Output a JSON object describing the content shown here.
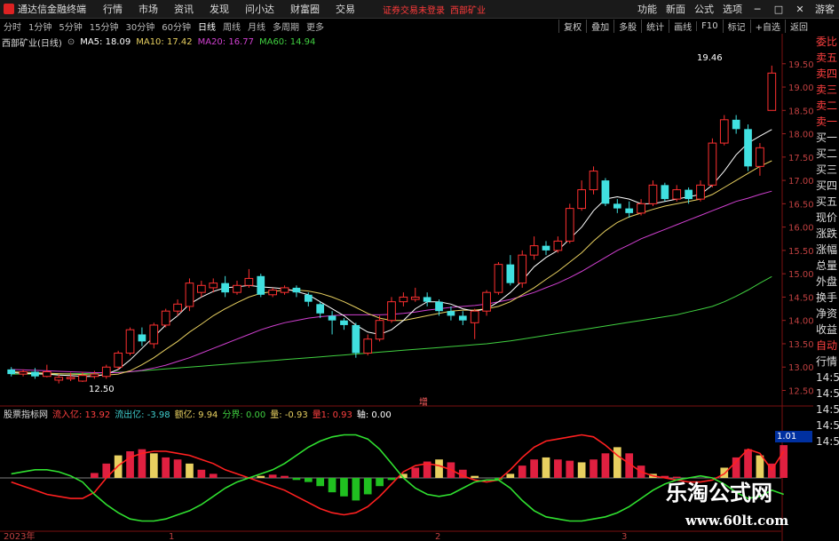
{
  "app": {
    "title": "通达信金融终端"
  },
  "menu": [
    "行情",
    "市场",
    "资讯",
    "发现",
    "问小达",
    "财富圈",
    "交易"
  ],
  "login_warning": "证券交易未登录",
  "stock_name_top": "西部矿业",
  "right_menu": [
    "功能",
    "新面",
    "公式",
    "选项"
  ],
  "right_menu_extra": "游客",
  "periods": [
    "分时",
    "1分钟",
    "5分钟",
    "15分钟",
    "30分钟",
    "60分钟",
    "日线",
    "周线",
    "月线",
    "多周期",
    "更多"
  ],
  "active_period": "日线",
  "tools": [
    "复权",
    "叠加",
    "多股",
    "统计",
    "画线",
    "F10",
    "标记",
    "+自选",
    "返回"
  ],
  "ma_legend": {
    "label": "西部矿业(日线)",
    "items": [
      {
        "text": "MA5: 18.09",
        "color": "#ffffff"
      },
      {
        "text": "MA10: 17.42",
        "color": "#e8d060"
      },
      {
        "text": "MA20: 16.77",
        "color": "#d040d0"
      },
      {
        "text": "MA60: 14.94",
        "color": "#40d040"
      }
    ]
  },
  "price_axis": [
    "19.50",
    "19.00",
    "18.50",
    "18.00",
    "17.50",
    "17.00",
    "16.50",
    "16.00",
    "15.50",
    "15.00",
    "14.50",
    "14.00",
    "13.50",
    "13.00",
    "12.50"
  ],
  "annotations": {
    "high": "19.46",
    "low": "12.50",
    "center_mark": "增"
  },
  "right_panel": [
    "委比",
    "卖五",
    "卖四",
    "卖三",
    "卖二",
    "卖一",
    "买一",
    "买二",
    "买三",
    "买四",
    "买五",
    "现价",
    "涨跌",
    "涨幅",
    "总量",
    "外盘",
    "换手",
    "净资",
    "收益",
    "自动",
    "行情",
    "14:5",
    "14:5",
    "14:5",
    "14:5",
    "14:5"
  ],
  "right_panel_value": "1.01",
  "indicator_legend": {
    "name": "股票指标网",
    "items": [
      {
        "text": "流入亿: 13.92",
        "color": "#ff4040"
      },
      {
        "text": "流出亿: -3.98",
        "color": "#40d0d0"
      },
      {
        "text": "额亿: 9.94",
        "color": "#e8d060"
      },
      {
        "text": "分界: 0.00",
        "color": "#40d040"
      },
      {
        "text": "量: -0.93",
        "color": "#e8d060"
      },
      {
        "text": "量1: 0.93",
        "color": "#ff4040"
      },
      {
        "text": "轴: 0.00",
        "color": "#ffffff"
      }
    ]
  },
  "bottom_axis": [
    "2023年",
    "1",
    "2",
    "3"
  ],
  "watermark": {
    "title": "乐淘公式网",
    "url": "www.60lt.com"
  },
  "chart_data": {
    "type": "candlestick",
    "ylim": [
      12.3,
      19.8
    ],
    "candles": [
      [
        12.95,
        12.85,
        13.0,
        12.8
      ],
      [
        12.85,
        12.9,
        12.95,
        12.8
      ],
      [
        12.9,
        12.8,
        12.98,
        12.75
      ],
      [
        12.8,
        12.9,
        13.05,
        12.78
      ],
      [
        12.72,
        12.78,
        12.85,
        12.65
      ],
      [
        12.75,
        12.78,
        12.88,
        12.7
      ],
      [
        12.7,
        12.82,
        12.9,
        12.68
      ],
      [
        12.8,
        12.85,
        12.92,
        12.75
      ],
      [
        12.8,
        13.0,
        13.05,
        12.75
      ],
      [
        13.0,
        13.3,
        13.35,
        12.95
      ],
      [
        13.3,
        13.8,
        13.85,
        13.25
      ],
      [
        13.7,
        13.55,
        13.85,
        13.45
      ],
      [
        13.5,
        13.9,
        13.95,
        13.4
      ],
      [
        13.9,
        14.2,
        14.25,
        13.85
      ],
      [
        14.2,
        14.35,
        14.45,
        14.1
      ],
      [
        14.3,
        14.8,
        14.9,
        14.2
      ],
      [
        14.6,
        14.75,
        14.85,
        14.5
      ],
      [
        14.7,
        14.8,
        14.9,
        14.6
      ],
      [
        14.8,
        14.6,
        14.95,
        14.5
      ],
      [
        14.6,
        14.75,
        14.85,
        14.55
      ],
      [
        14.75,
        14.9,
        15.1,
        14.7
      ],
      [
        14.95,
        14.55,
        15.0,
        14.5
      ],
      [
        14.55,
        14.65,
        14.7,
        14.5
      ],
      [
        14.6,
        14.7,
        14.75,
        14.55
      ],
      [
        14.7,
        14.6,
        14.75,
        14.5
      ],
      [
        14.55,
        14.4,
        14.6,
        14.3
      ],
      [
        14.35,
        14.15,
        14.4,
        14.05
      ],
      [
        14.1,
        14.0,
        14.2,
        13.7
      ],
      [
        14.0,
        13.9,
        14.05,
        13.8
      ],
      [
        13.9,
        13.3,
        13.95,
        13.2
      ],
      [
        13.3,
        13.6,
        13.7,
        13.25
      ],
      [
        13.6,
        14.0,
        14.1,
        13.55
      ],
      [
        14.0,
        14.4,
        14.5,
        13.95
      ],
      [
        14.4,
        14.5,
        14.6,
        14.3
      ],
      [
        14.45,
        14.5,
        14.7,
        14.4
      ],
      [
        14.5,
        14.4,
        14.6,
        14.3
      ],
      [
        14.4,
        14.2,
        14.45,
        14.1
      ],
      [
        14.2,
        14.1,
        14.3,
        14.0
      ],
      [
        14.1,
        14.0,
        14.2,
        13.9
      ],
      [
        13.95,
        14.2,
        14.25,
        13.6
      ],
      [
        14.2,
        14.6,
        14.65,
        14.1
      ],
      [
        14.6,
        15.2,
        15.25,
        14.55
      ],
      [
        15.2,
        14.8,
        15.4,
        14.75
      ],
      [
        14.8,
        15.4,
        15.5,
        14.7
      ],
      [
        15.4,
        15.6,
        15.8,
        15.3
      ],
      [
        15.6,
        15.5,
        15.7,
        15.4
      ],
      [
        15.5,
        15.7,
        15.8,
        15.45
      ],
      [
        15.7,
        16.4,
        16.5,
        15.65
      ],
      [
        16.4,
        16.8,
        17.0,
        16.35
      ],
      [
        16.8,
        17.2,
        17.3,
        16.7
      ],
      [
        17.0,
        16.5,
        17.05,
        16.45
      ],
      [
        16.5,
        16.4,
        16.6,
        16.3
      ],
      [
        16.4,
        16.3,
        16.55,
        16.2
      ],
      [
        16.3,
        16.5,
        16.6,
        16.25
      ],
      [
        16.5,
        16.9,
        17.0,
        16.45
      ],
      [
        16.9,
        16.6,
        16.95,
        16.55
      ],
      [
        16.6,
        16.8,
        16.9,
        16.55
      ],
      [
        16.8,
        16.6,
        16.85,
        16.5
      ],
      [
        16.6,
        16.9,
        17.0,
        16.55
      ],
      [
        16.9,
        17.8,
        17.9,
        16.85
      ],
      [
        17.8,
        18.3,
        18.4,
        17.75
      ],
      [
        18.3,
        18.1,
        18.4,
        18.0
      ],
      [
        18.1,
        17.3,
        18.2,
        17.2
      ],
      [
        17.3,
        17.7,
        17.8,
        17.1
      ],
      [
        18.5,
        19.3,
        19.46,
        18.5
      ]
    ],
    "ma5": [
      12.88,
      12.87,
      12.86,
      12.85,
      12.83,
      12.82,
      12.8,
      12.8,
      12.85,
      12.95,
      13.15,
      13.4,
      13.65,
      13.9,
      14.1,
      14.35,
      14.5,
      14.62,
      14.7,
      14.72,
      14.75,
      14.72,
      14.7,
      14.68,
      14.62,
      14.55,
      14.4,
      14.25,
      14.1,
      13.9,
      13.75,
      13.7,
      13.8,
      14.0,
      14.25,
      14.4,
      14.4,
      14.35,
      14.25,
      14.2,
      14.25,
      14.4,
      14.6,
      14.85,
      15.15,
      15.35,
      15.5,
      15.75,
      16.0,
      16.35,
      16.6,
      16.65,
      16.6,
      16.5,
      16.5,
      16.55,
      16.6,
      16.65,
      16.7,
      16.9,
      17.2,
      17.55,
      17.8,
      17.95,
      18.09
    ],
    "ma10": [
      12.9,
      12.89,
      12.88,
      12.87,
      12.86,
      12.85,
      12.84,
      12.83,
      12.83,
      12.85,
      12.92,
      13.05,
      13.2,
      13.38,
      13.55,
      13.75,
      13.92,
      14.1,
      14.25,
      14.38,
      14.5,
      14.58,
      14.62,
      14.65,
      14.65,
      14.63,
      14.58,
      14.5,
      14.4,
      14.28,
      14.15,
      14.05,
      14.0,
      14.0,
      14.05,
      14.1,
      14.15,
      14.2,
      14.22,
      14.22,
      14.25,
      14.3,
      14.4,
      14.55,
      14.7,
      14.88,
      15.05,
      15.25,
      15.45,
      15.7,
      15.92,
      16.1,
      16.22,
      16.3,
      16.38,
      16.45,
      16.5,
      16.55,
      16.6,
      16.7,
      16.85,
      17.0,
      17.15,
      17.3,
      17.42
    ],
    "ma20": [
      12.95,
      12.94,
      12.93,
      12.92,
      12.91,
      12.9,
      12.89,
      12.88,
      12.88,
      12.88,
      12.9,
      12.93,
      12.98,
      13.04,
      13.12,
      13.2,
      13.3,
      13.4,
      13.5,
      13.6,
      13.7,
      13.8,
      13.88,
      13.95,
      14.0,
      14.05,
      14.08,
      14.1,
      14.12,
      14.12,
      14.12,
      14.12,
      14.13,
      14.15,
      14.18,
      14.22,
      14.25,
      14.28,
      14.3,
      14.32,
      14.35,
      14.4,
      14.45,
      14.52,
      14.6,
      14.7,
      14.8,
      14.92,
      15.05,
      15.2,
      15.35,
      15.5,
      15.62,
      15.75,
      15.85,
      15.95,
      16.05,
      16.15,
      16.25,
      16.35,
      16.45,
      16.55,
      16.62,
      16.7,
      16.77
    ],
    "ma60": [
      12.85,
      12.85,
      12.85,
      12.85,
      12.85,
      12.86,
      12.86,
      12.87,
      12.88,
      12.89,
      12.9,
      12.92,
      12.94,
      12.96,
      12.98,
      13.0,
      13.02,
      13.04,
      13.06,
      13.08,
      13.1,
      13.12,
      13.14,
      13.16,
      13.18,
      13.2,
      13.22,
      13.24,
      13.26,
      13.28,
      13.3,
      13.32,
      13.34,
      13.36,
      13.38,
      13.4,
      13.42,
      13.44,
      13.46,
      13.48,
      13.5,
      13.53,
      13.56,
      13.6,
      13.64,
      13.68,
      13.72,
      13.76,
      13.8,
      13.84,
      13.88,
      13.92,
      13.96,
      14.0,
      14.04,
      14.08,
      14.12,
      14.18,
      14.24,
      14.3,
      14.4,
      14.52,
      14.65,
      14.8,
      14.94
    ],
    "indicator": {
      "ylim": [
        -1.3,
        1.3
      ],
      "bars": [
        0,
        0,
        0,
        0,
        0,
        0,
        0,
        0.12,
        0.35,
        0.55,
        0.65,
        0.7,
        0.6,
        0.5,
        0.45,
        0.35,
        0.2,
        0.1,
        0,
        0,
        0,
        0.05,
        0.08,
        0.05,
        -0.05,
        -0.1,
        -0.2,
        -0.35,
        -0.45,
        -0.55,
        -0.4,
        -0.2,
        -0.05,
        0.1,
        0.25,
        0.4,
        0.45,
        0.38,
        0.2,
        0.05,
        0,
        -0.05,
        0.1,
        0.3,
        0.45,
        0.5,
        0.45,
        0.42,
        0.38,
        0.45,
        0.6,
        0.75,
        0.6,
        0.3,
        0.1,
        0.05,
        0.03,
        0,
        0,
        0,
        0.25,
        0.5,
        0.7,
        0.55,
        0.35,
        0.8
      ],
      "red_line": [
        -0.1,
        -0.2,
        -0.3,
        -0.4,
        -0.45,
        -0.5,
        -0.5,
        -0.35,
        0.0,
        0.3,
        0.5,
        0.6,
        0.65,
        0.65,
        0.6,
        0.55,
        0.45,
        0.35,
        0.2,
        0.1,
        0.0,
        -0.1,
        -0.2,
        -0.3,
        -0.45,
        -0.6,
        -0.75,
        -0.85,
        -0.9,
        -0.85,
        -0.7,
        -0.45,
        -0.15,
        0.15,
        0.3,
        0.35,
        0.3,
        0.2,
        0.05,
        -0.05,
        -0.1,
        -0.05,
        0.2,
        0.5,
        0.75,
        0.9,
        0.95,
        1.0,
        1.05,
        1.0,
        0.8,
        0.55,
        0.35,
        0.15,
        0.05,
        0.0,
        -0.05,
        -0.1,
        -0.1,
        -0.05,
        0.1,
        0.4,
        0.7,
        0.6,
        0.2,
        0.65
      ],
      "green_line": [
        0.1,
        0.15,
        0.2,
        0.2,
        0.15,
        0.05,
        -0.1,
        -0.4,
        -0.65,
        -0.85,
        -1.0,
        -1.05,
        -1.05,
        -1.0,
        -0.9,
        -0.8,
        -0.65,
        -0.45,
        -0.25,
        -0.1,
        0.0,
        0.1,
        0.2,
        0.35,
        0.55,
        0.75,
        0.9,
        1.0,
        1.05,
        1.05,
        0.95,
        0.7,
        0.35,
        0.0,
        -0.25,
        -0.4,
        -0.45,
        -0.4,
        -0.25,
        -0.1,
        -0.05,
        -0.05,
        -0.25,
        -0.55,
        -0.8,
        -0.95,
        -1.0,
        -1.05,
        -1.05,
        -1.0,
        -0.95,
        -0.85,
        -0.7,
        -0.5,
        -0.3,
        -0.15,
        -0.05,
        0.0,
        0.05,
        0.0,
        -0.15,
        -0.35,
        -0.5,
        -0.45,
        -0.3,
        -0.4
      ]
    }
  }
}
